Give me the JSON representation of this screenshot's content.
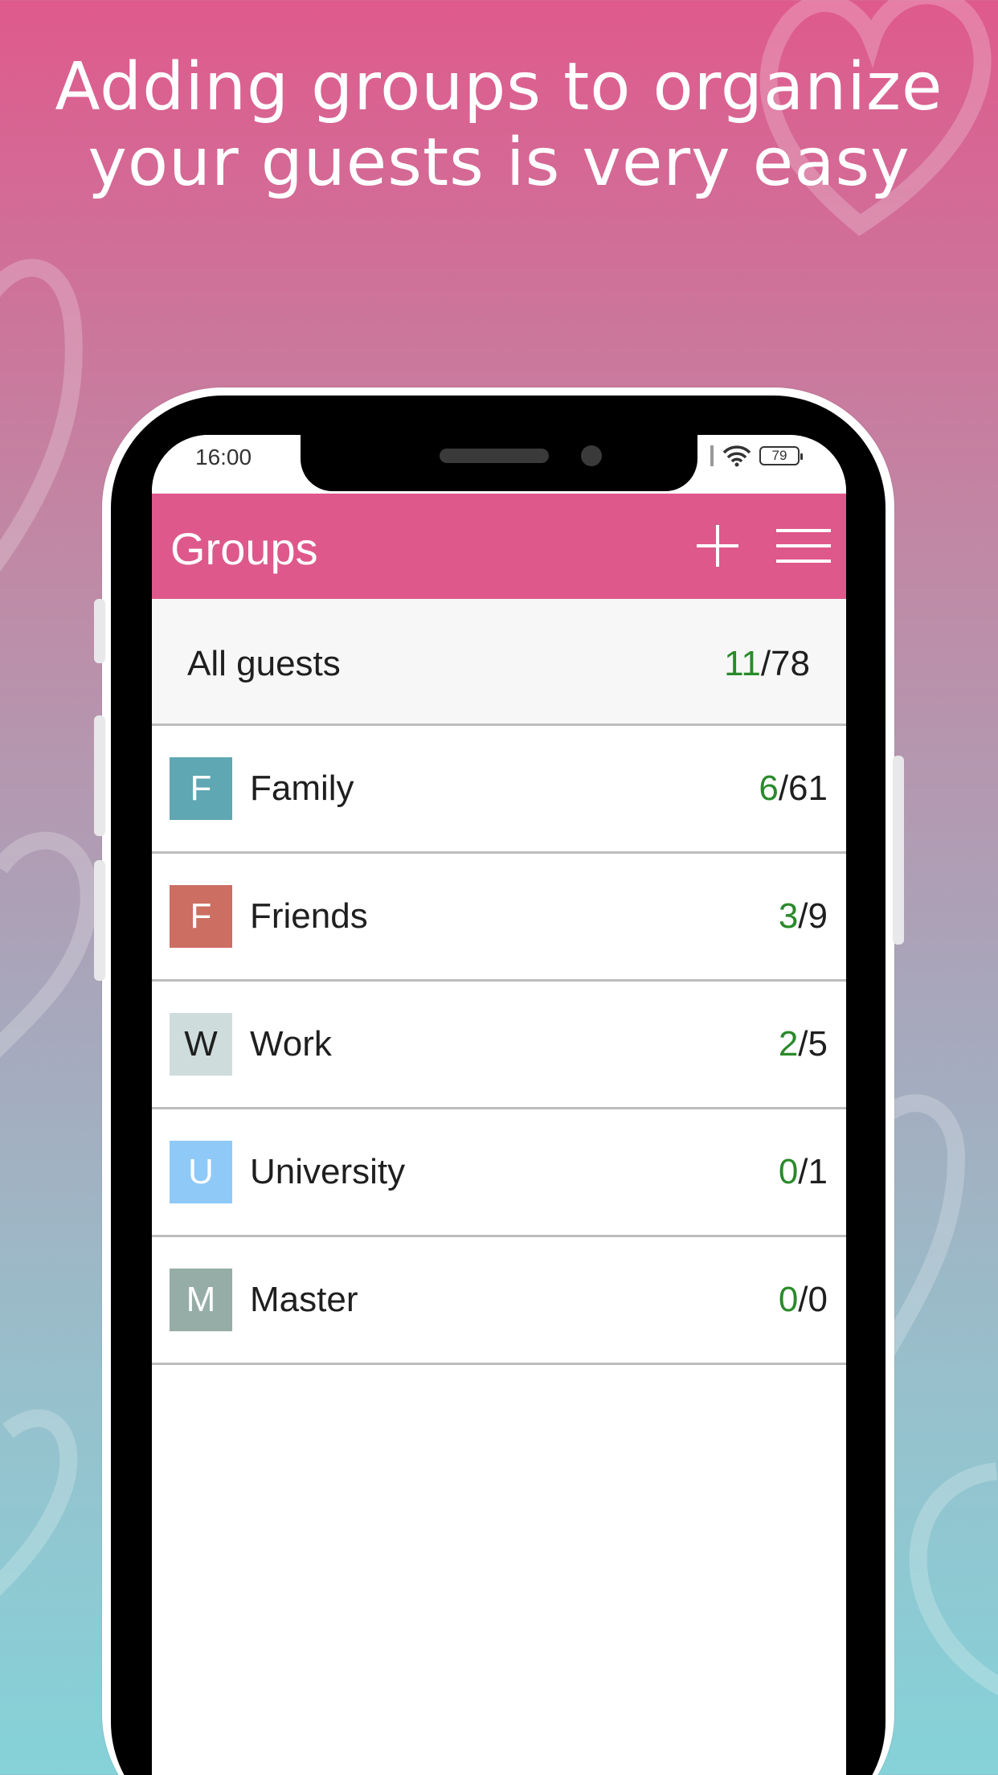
{
  "headline": {
    "line1": "Adding groups to organize",
    "line2": "your guests is very easy"
  },
  "status_bar": {
    "time": "16:00",
    "battery": "79"
  },
  "header": {
    "title": "Groups",
    "add_icon": "plus-icon",
    "menu_icon": "hamburger-menu-icon",
    "color": "#de588b"
  },
  "all_guests": {
    "label": "All guests",
    "done": "11",
    "total": "/78"
  },
  "groups": [
    {
      "letter": "F",
      "name": "Family",
      "done": "6",
      "total": "/61",
      "color": "#5fa7b2",
      "letter_color": "#ffffff"
    },
    {
      "letter": "F",
      "name": "Friends",
      "done": "3",
      "total": "/9",
      "color": "#cc6e62",
      "letter_color": "#ffffff"
    },
    {
      "letter": "W",
      "name": "Work",
      "done": "2",
      "total": "/5",
      "color": "#cfdcdc",
      "letter_color": "#1f1f1f"
    },
    {
      "letter": "U",
      "name": "University",
      "done": "0",
      "total": "/1",
      "color": "#8fc9f7",
      "letter_color": "#ffffff"
    },
    {
      "letter": "M",
      "name": "Master",
      "done": "0",
      "total": "/0",
      "color": "#95ada6",
      "letter_color": "#ffffff"
    }
  ],
  "colors": {
    "done_count": "#2a8a2a",
    "divider": "#bdbdbd"
  }
}
